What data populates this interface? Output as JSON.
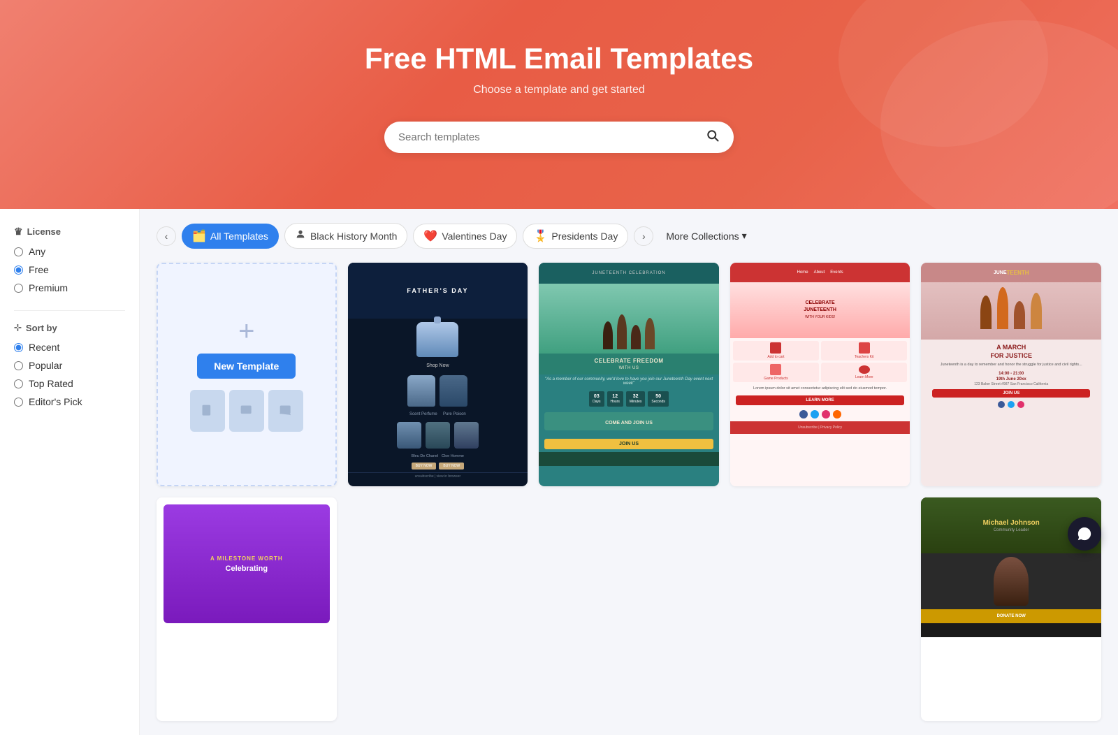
{
  "hero": {
    "title": "Free HTML Email Templates",
    "subtitle": "Choose a template and get started",
    "search_placeholder": "Search templates"
  },
  "sidebar": {
    "license_label": "License",
    "license_options": [
      "Any",
      "Free",
      "Premium"
    ],
    "license_selected": "Free",
    "sortby_label": "Sort by",
    "sortby_options": [
      "Recent",
      "Popular",
      "Top Rated",
      "Editor's Pick"
    ],
    "sortby_selected": "Recent"
  },
  "filter_tabs": [
    {
      "id": "all",
      "label": "All Templates",
      "icon": "🗂️",
      "active": true
    },
    {
      "id": "black-history",
      "label": "Black History Month",
      "icon": "👤",
      "active": false
    },
    {
      "id": "valentines",
      "label": "Valentines Day",
      "icon": "❤️",
      "active": false
    },
    {
      "id": "presidents",
      "label": "Presidents Day",
      "icon": "🎖️",
      "active": false
    }
  ],
  "more_collections": "More Collections",
  "new_template_label": "New Template",
  "templates": [
    {
      "id": "new",
      "type": "new"
    },
    {
      "id": "perfume",
      "type": "perfume",
      "name": "Father's Day Perfume"
    },
    {
      "id": "juneteenth",
      "type": "juneteenth",
      "name": "Celebrate Freedom"
    },
    {
      "id": "celebrate",
      "type": "celebrate",
      "name": "Celebrate Juneteenth"
    },
    {
      "id": "march",
      "type": "march",
      "name": "A March For Justice"
    }
  ],
  "bottom_templates": [
    {
      "id": "milestone",
      "type": "milestone",
      "name": "A Milestone Worth Celebrating"
    },
    {
      "id": "michael",
      "type": "michael",
      "name": "Michael Johnson"
    }
  ],
  "chat": {
    "icon_label": "chat-support-icon"
  }
}
